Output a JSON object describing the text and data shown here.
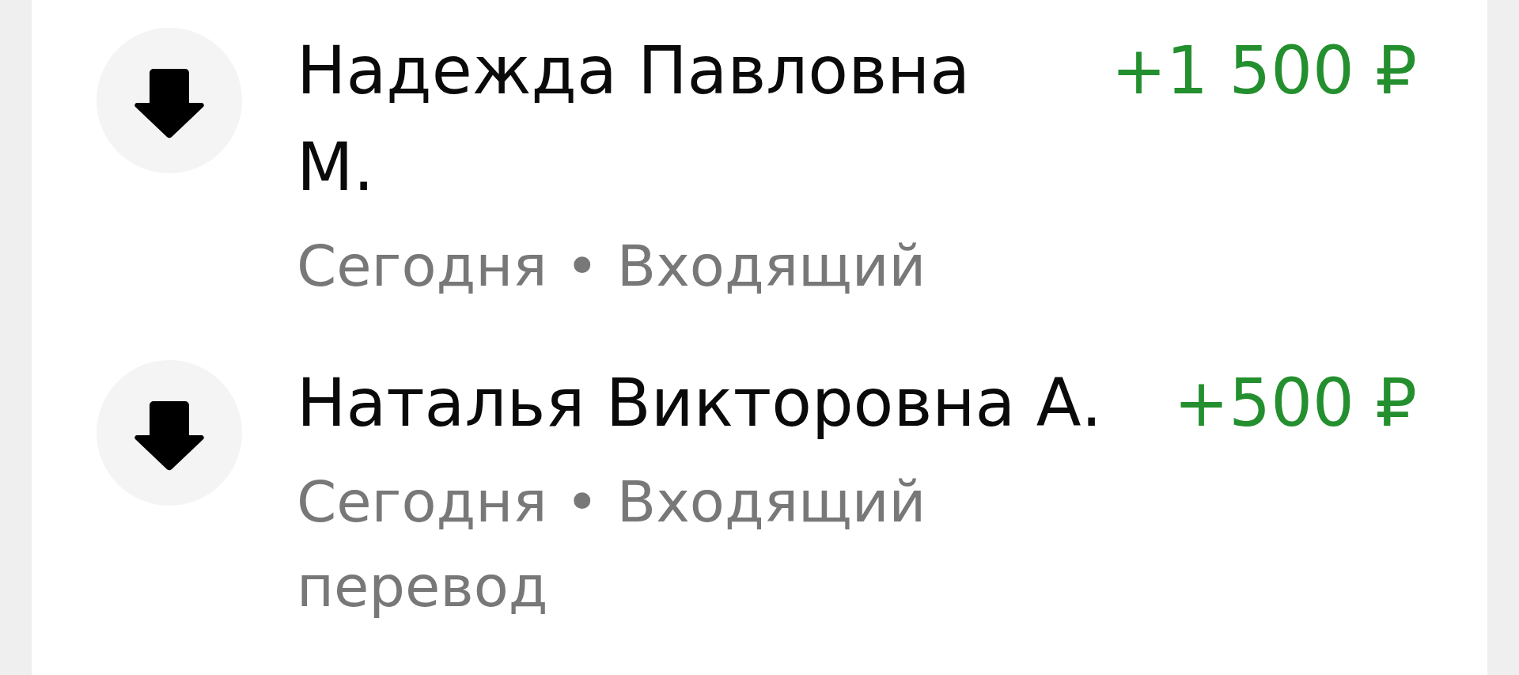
{
  "transactions": [
    {
      "kind": "incoming",
      "name": "Надежда Павловна М.",
      "meta": "Сегодня • Входящий",
      "amount": "+1 500 ₽"
    },
    {
      "kind": "incoming",
      "name": "Наталья Викторовна А.",
      "meta": "Сегодня • Входящий перевод",
      "amount": "+500 ₽"
    }
  ]
}
